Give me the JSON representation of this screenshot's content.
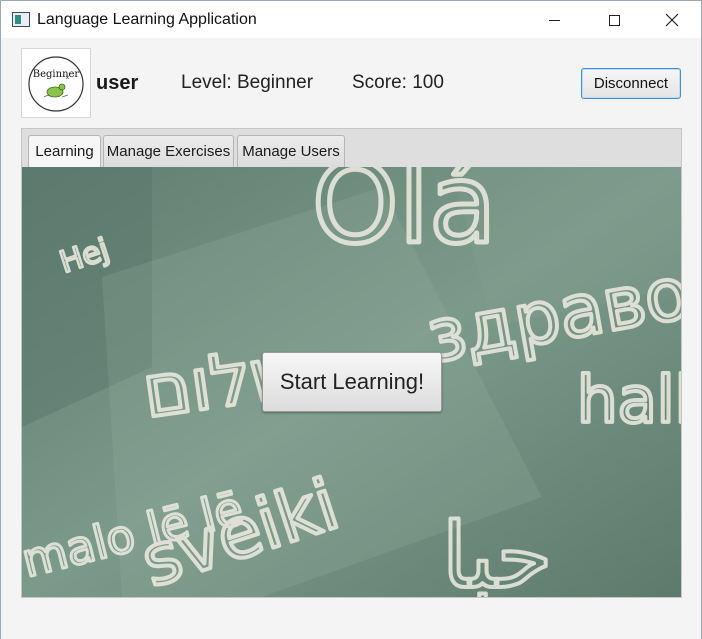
{
  "window": {
    "title": "Language Learning Application"
  },
  "header": {
    "logo_text": "Beginner",
    "username": "user",
    "level": "Level: Beginner",
    "score": "Score: 100",
    "disconnect_label": "Disconnect"
  },
  "tabs": [
    {
      "label": "Learning",
      "active": true
    },
    {
      "label": "Manage Exercises",
      "active": false
    },
    {
      "label": "Manage Users",
      "active": false
    }
  ],
  "learning": {
    "start_label": "Start Learning!",
    "chalkboard_words": [
      "Olá",
      "Hej",
      "שלום",
      "здраво",
      "hall",
      "malo lē lē",
      "sveiki",
      "حبا"
    ]
  },
  "colors": {
    "chalkboard": "#6b8a7b",
    "chalk": "#e8e8dc",
    "accent": "#3f8fd6"
  }
}
